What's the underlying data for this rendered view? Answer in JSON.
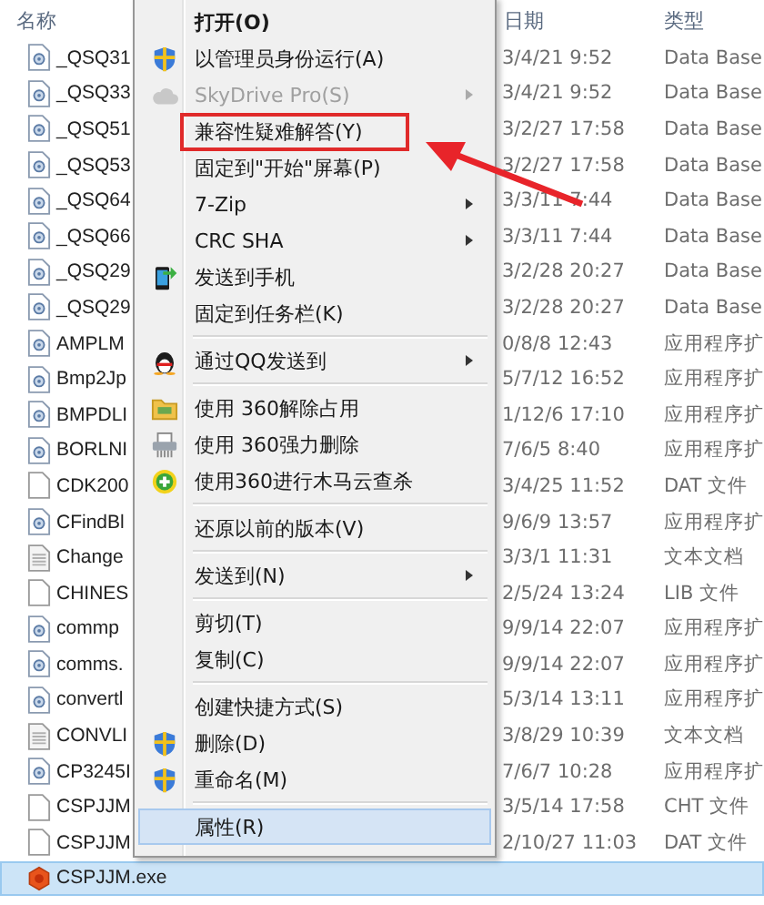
{
  "columns": [
    "名称",
    "日期",
    "类型"
  ],
  "files": [
    {
      "name": "_QSQ31",
      "date": "3/4/21 9:52",
      "type": "Data Base",
      "kind": "dll",
      "selected": false
    },
    {
      "name": "_QSQ33",
      "date": "3/4/21 9:52",
      "type": "Data Base",
      "kind": "dll",
      "selected": false
    },
    {
      "name": "_QSQ51",
      "date": "3/2/27 17:58",
      "type": "Data Base",
      "kind": "dll",
      "selected": false
    },
    {
      "name": "_QSQ53",
      "date": "3/2/27 17:58",
      "type": "Data Base",
      "kind": "dll",
      "selected": false
    },
    {
      "name": "_QSQ64",
      "date": "3/3/11 7:44",
      "type": "Data Base",
      "kind": "dll",
      "selected": false
    },
    {
      "name": "_QSQ66",
      "date": "3/3/11 7:44",
      "type": "Data Base",
      "kind": "dll",
      "selected": false
    },
    {
      "name": "_QSQ29",
      "date": "3/2/28 20:27",
      "type": "Data Base",
      "kind": "dll",
      "selected": false
    },
    {
      "name": "_QSQ29",
      "date": "3/2/28 20:27",
      "type": "Data Base",
      "kind": "dll",
      "selected": false
    },
    {
      "name": "AMPLM",
      "date": "0/8/8 12:43",
      "type": "应用程序扩",
      "kind": "dll",
      "selected": false
    },
    {
      "name": "Bmp2Jp",
      "date": "5/7/12 16:52",
      "type": "应用程序扩",
      "kind": "dll",
      "selected": false
    },
    {
      "name": "BMPDLI",
      "date": "1/12/6 17:10",
      "type": "应用程序扩",
      "kind": "dll",
      "selected": false
    },
    {
      "name": "BORLNI",
      "date": "7/6/5 8:40",
      "type": "应用程序扩",
      "kind": "dll",
      "selected": false
    },
    {
      "name": "CDK200",
      "date": "3/4/25 11:52",
      "type": "DAT 文件",
      "kind": "file",
      "selected": false
    },
    {
      "name": "CFindBl",
      "date": "9/6/9 13:57",
      "type": "应用程序扩",
      "kind": "dll",
      "selected": false
    },
    {
      "name": "Change",
      "date": "3/3/1 11:31",
      "type": "文本文档",
      "kind": "text",
      "selected": false
    },
    {
      "name": "CHINES",
      "date": "2/5/24 13:24",
      "type": "LIB 文件",
      "kind": "file",
      "selected": false
    },
    {
      "name": "commp",
      "date": "9/9/14 22:07",
      "type": "应用程序扩",
      "kind": "dll",
      "selected": false
    },
    {
      "name": "comms.",
      "date": "9/9/14 22:07",
      "type": "应用程序扩",
      "kind": "dll",
      "selected": false
    },
    {
      "name": "convertl",
      "date": "5/3/14 13:11",
      "type": "应用程序扩",
      "kind": "dll",
      "selected": false
    },
    {
      "name": "CONVLI",
      "date": "3/8/29 10:39",
      "type": "文本文档",
      "kind": "text",
      "selected": false
    },
    {
      "name": "CP3245I",
      "date": "7/6/7 10:28",
      "type": "应用程序扩",
      "kind": "dll",
      "selected": false
    },
    {
      "name": "CSPJJM",
      "date": "3/5/14 17:58",
      "type": "CHT 文件",
      "kind": "file",
      "selected": false
    },
    {
      "name": "CSPJJM",
      "date": "2/10/27 11:03",
      "type": "DAT 文件",
      "kind": "file",
      "selected": false
    },
    {
      "name": "CSPJJM.exe",
      "kind": "exe",
      "selected": true
    }
  ],
  "menu": [
    {
      "kind": "plain",
      "label": "打开(O)",
      "default": true,
      "disabled": false,
      "submenu": false,
      "selected": false,
      "boxed": false
    },
    {
      "kind": "shield",
      "label": "以管理员身份运行(A)",
      "default": false,
      "disabled": false,
      "submenu": false,
      "selected": false,
      "boxed": false
    },
    {
      "kind": "cloud",
      "label": "SkyDrive Pro(S)",
      "default": false,
      "disabled": true,
      "submenu": true,
      "selected": false,
      "boxed": false
    },
    {
      "kind": "plain",
      "label": "兼容性疑难解答(Y)",
      "default": false,
      "disabled": false,
      "submenu": false,
      "selected": false,
      "boxed": true
    },
    {
      "kind": "plain",
      "label": "固定到\"开始\"屏幕(P)",
      "default": false,
      "disabled": false,
      "submenu": false,
      "selected": false,
      "boxed": false
    },
    {
      "kind": "plain",
      "label": "7-Zip",
      "default": false,
      "disabled": false,
      "submenu": true,
      "selected": false,
      "boxed": false
    },
    {
      "kind": "plain",
      "label": "CRC SHA",
      "default": false,
      "disabled": false,
      "submenu": true,
      "selected": false,
      "boxed": false
    },
    {
      "kind": "phone",
      "label": "发送到手机",
      "default": false,
      "disabled": false,
      "submenu": false,
      "selected": false,
      "boxed": false
    },
    {
      "kind": "plain",
      "label": "固定到任务栏(K)",
      "default": false,
      "disabled": false,
      "submenu": false,
      "selected": false,
      "boxed": false
    },
    {
      "kind": "separator"
    },
    {
      "kind": "penguin",
      "label": "通过QQ发送到",
      "default": false,
      "disabled": false,
      "submenu": true,
      "selected": false,
      "boxed": false
    },
    {
      "kind": "separator"
    },
    {
      "kind": "folder",
      "label": "使用 360解除占用",
      "default": false,
      "disabled": false,
      "submenu": false,
      "selected": false,
      "boxed": false
    },
    {
      "kind": "shredder",
      "label": "使用 360强力删除",
      "default": false,
      "disabled": false,
      "submenu": false,
      "selected": false,
      "boxed": false
    },
    {
      "kind": "plus",
      "label": "使用360进行木马云查杀",
      "default": false,
      "disabled": false,
      "submenu": false,
      "selected": false,
      "boxed": false
    },
    {
      "kind": "separator"
    },
    {
      "kind": "plain",
      "label": "还原以前的版本(V)",
      "default": false,
      "disabled": false,
      "submenu": false,
      "selected": false,
      "boxed": false
    },
    {
      "kind": "separator"
    },
    {
      "kind": "plain",
      "label": "发送到(N)",
      "default": false,
      "disabled": false,
      "submenu": true,
      "selected": false,
      "boxed": false
    },
    {
      "kind": "separator"
    },
    {
      "kind": "plain",
      "label": "剪切(T)",
      "default": false,
      "disabled": false,
      "submenu": false,
      "selected": false,
      "boxed": false
    },
    {
      "kind": "plain",
      "label": "复制(C)",
      "default": false,
      "disabled": false,
      "submenu": false,
      "selected": false,
      "boxed": false
    },
    {
      "kind": "separator"
    },
    {
      "kind": "plain",
      "label": "创建快捷方式(S)",
      "default": false,
      "disabled": false,
      "submenu": false,
      "selected": false,
      "boxed": false
    },
    {
      "kind": "shield",
      "label": "删除(D)",
      "default": false,
      "disabled": false,
      "submenu": false,
      "selected": false,
      "boxed": false
    },
    {
      "kind": "shield",
      "label": "重命名(M)",
      "default": false,
      "disabled": false,
      "submenu": false,
      "selected": false,
      "boxed": false
    },
    {
      "kind": "separator"
    },
    {
      "kind": "plain",
      "label": "属性(R)",
      "default": false,
      "disabled": false,
      "submenu": false,
      "selected": true,
      "boxed": false
    }
  ]
}
